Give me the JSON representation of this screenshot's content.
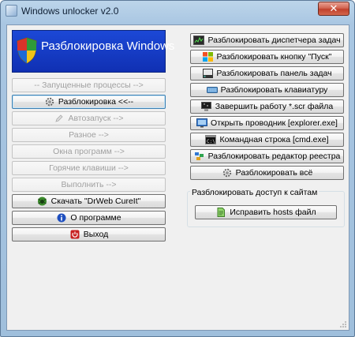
{
  "window": {
    "title": "Windows unlocker v2.0",
    "close_glyph": "✕"
  },
  "banner": {
    "title": "Разблокировка Windows",
    "icon": "security-shield-icon"
  },
  "left_buttons": [
    {
      "label": "-- Запущенные процессы -->",
      "enabled": false,
      "icon": ""
    },
    {
      "label": "Разблокировка <<--",
      "enabled": true,
      "focused": true,
      "icon": "gear-icon"
    },
    {
      "label": "Автозапуск -->",
      "enabled": false,
      "icon": "pencil-icon"
    },
    {
      "label": "Разное -->",
      "enabled": false,
      "icon": ""
    },
    {
      "label": "Окна программ -->",
      "enabled": false,
      "icon": ""
    },
    {
      "label": "Горячие клавиши -->",
      "enabled": false,
      "icon": ""
    },
    {
      "label": "Выполнить -->",
      "enabled": false,
      "icon": ""
    },
    {
      "label": "Скачать \"DrWeb CureIt\"",
      "enabled": true,
      "icon": "drweb-spider-icon"
    },
    {
      "label": "О программе",
      "enabled": true,
      "icon": "info-icon"
    },
    {
      "label": "Выход",
      "enabled": true,
      "icon": "power-icon"
    }
  ],
  "right_buttons": [
    {
      "label": "Разблокировать диспетчера задач",
      "icon": "task-manager-icon"
    },
    {
      "label": "Разблокировать кнопку \"Пуск\"",
      "icon": "windows-flag-icon"
    },
    {
      "label": "Разблокировать панель задач",
      "icon": "taskbar-icon"
    },
    {
      "label": "Разблокировать клавиатуру",
      "icon": "keyboard-icon"
    },
    {
      "label": "Завершить работу *.scr файла",
      "icon": "screensaver-icon"
    },
    {
      "label": "Открыть проводник [explorer.exe]",
      "icon": "explorer-icon"
    },
    {
      "label": "Командная строка [cmd.exe]",
      "icon": "cmd-icon"
    },
    {
      "label": "Разблокировать редактор реестра",
      "icon": "registry-icon"
    },
    {
      "label": "Разблокировать всё",
      "icon": "gear-icon"
    }
  ],
  "sites_group": {
    "title": "Разблокировать доступ к сайтам",
    "button_label": "Исправить hosts файл",
    "button_icon": "hosts-file-icon"
  }
}
